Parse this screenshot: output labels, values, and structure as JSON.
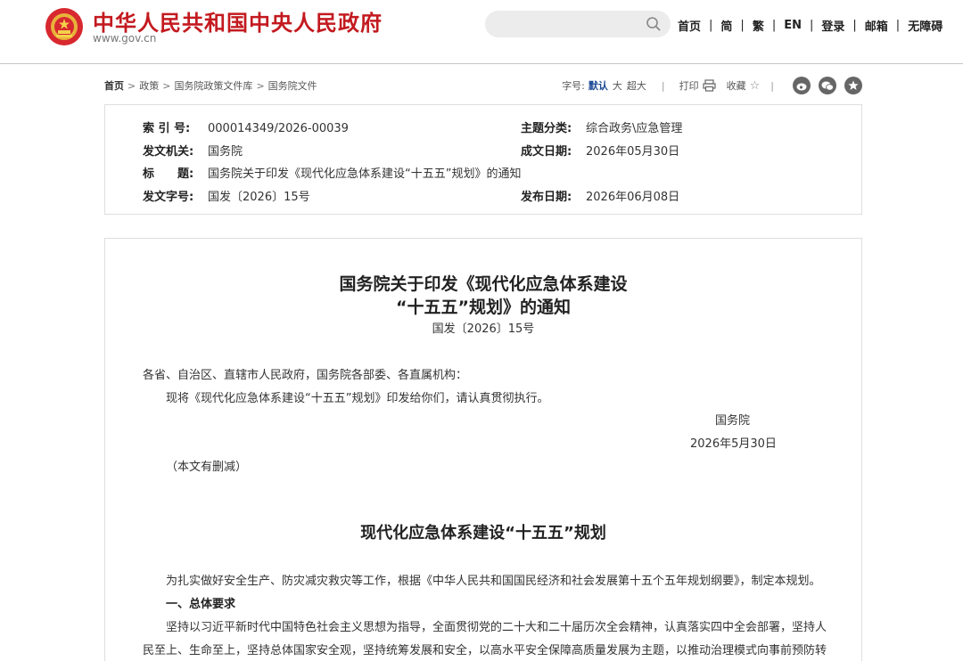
{
  "header": {
    "site_title": "中华人民共和国中央人民政府",
    "site_url": "www.gov.cn",
    "search": {
      "placeholder": ""
    },
    "nav": [
      "首页",
      "简",
      "繁",
      "EN",
      "登录",
      "邮箱",
      "无障碍"
    ]
  },
  "toolbar": {
    "breadcrumb": [
      "首页",
      "政策",
      "国务院政策文件库",
      "国务院文件"
    ],
    "fontsize_label": "字号:",
    "fontsizes": [
      "默认",
      "大",
      "超大"
    ],
    "print_label": "打印",
    "favorite_label": "收藏",
    "share_icons": [
      "weibo-icon",
      "wechat-icon",
      "qzone-icon"
    ]
  },
  "meta": {
    "index_label": "索 引 号:",
    "index_value": "000014349/2026-00039",
    "topic_label": "主题分类:",
    "topic_value": "综合政务\\应急管理",
    "issuer_label": "发文机关:",
    "issuer_value": "国务院",
    "created_label": "成文日期:",
    "created_value": "2026年05月30日",
    "title_label": "标　　题:",
    "title_value": "国务院关于印发《现代化应急体系建设“十五五”规划》的通知",
    "docno_label": "发文字号:",
    "docno_value": "国发〔2026〕15号",
    "published_label": "发布日期:",
    "published_value": "2026年06月08日"
  },
  "article": {
    "title_line1": "国务院关于印发《现代化应急体系建设",
    "title_line2": "“十五五”规划》的通知",
    "doc_number": "国发〔2026〕15号",
    "addressee": "各省、自治区、直辖市人民政府，国务院各部委、各直属机构：",
    "body": "现将《现代化应急体系建设“十五五”规划》印发给你们，请认真贯彻执行。",
    "signature": "国务院",
    "sign_date": "2026年5月30日",
    "note": "（本文有删减）",
    "section_title": "现代化应急体系建设“十五五”规划",
    "intro": "为扎实做好安全生产、防灾减灾救灾等工作，根据《中华人民共和国国民经济和社会发展第十五个五年规划纲要》，制定本规划。",
    "heading1": "一、总体要求",
    "para1_line1": "坚持以习近平新时代中国特色社会主义思想为指导，全面贯彻党的二十大和二十届历次全会精神，认真落实四中全会部署，坚持人",
    "para1_line2": "民至上、生命至上，坚持总体国家安全观，坚持统筹发展和安全，以高水平安全保障高质量发展为主题，以推动治理模式向事前预防转"
  },
  "colors": {
    "brand_red": "#c31a1f",
    "active_blue": "#1e4b95"
  }
}
